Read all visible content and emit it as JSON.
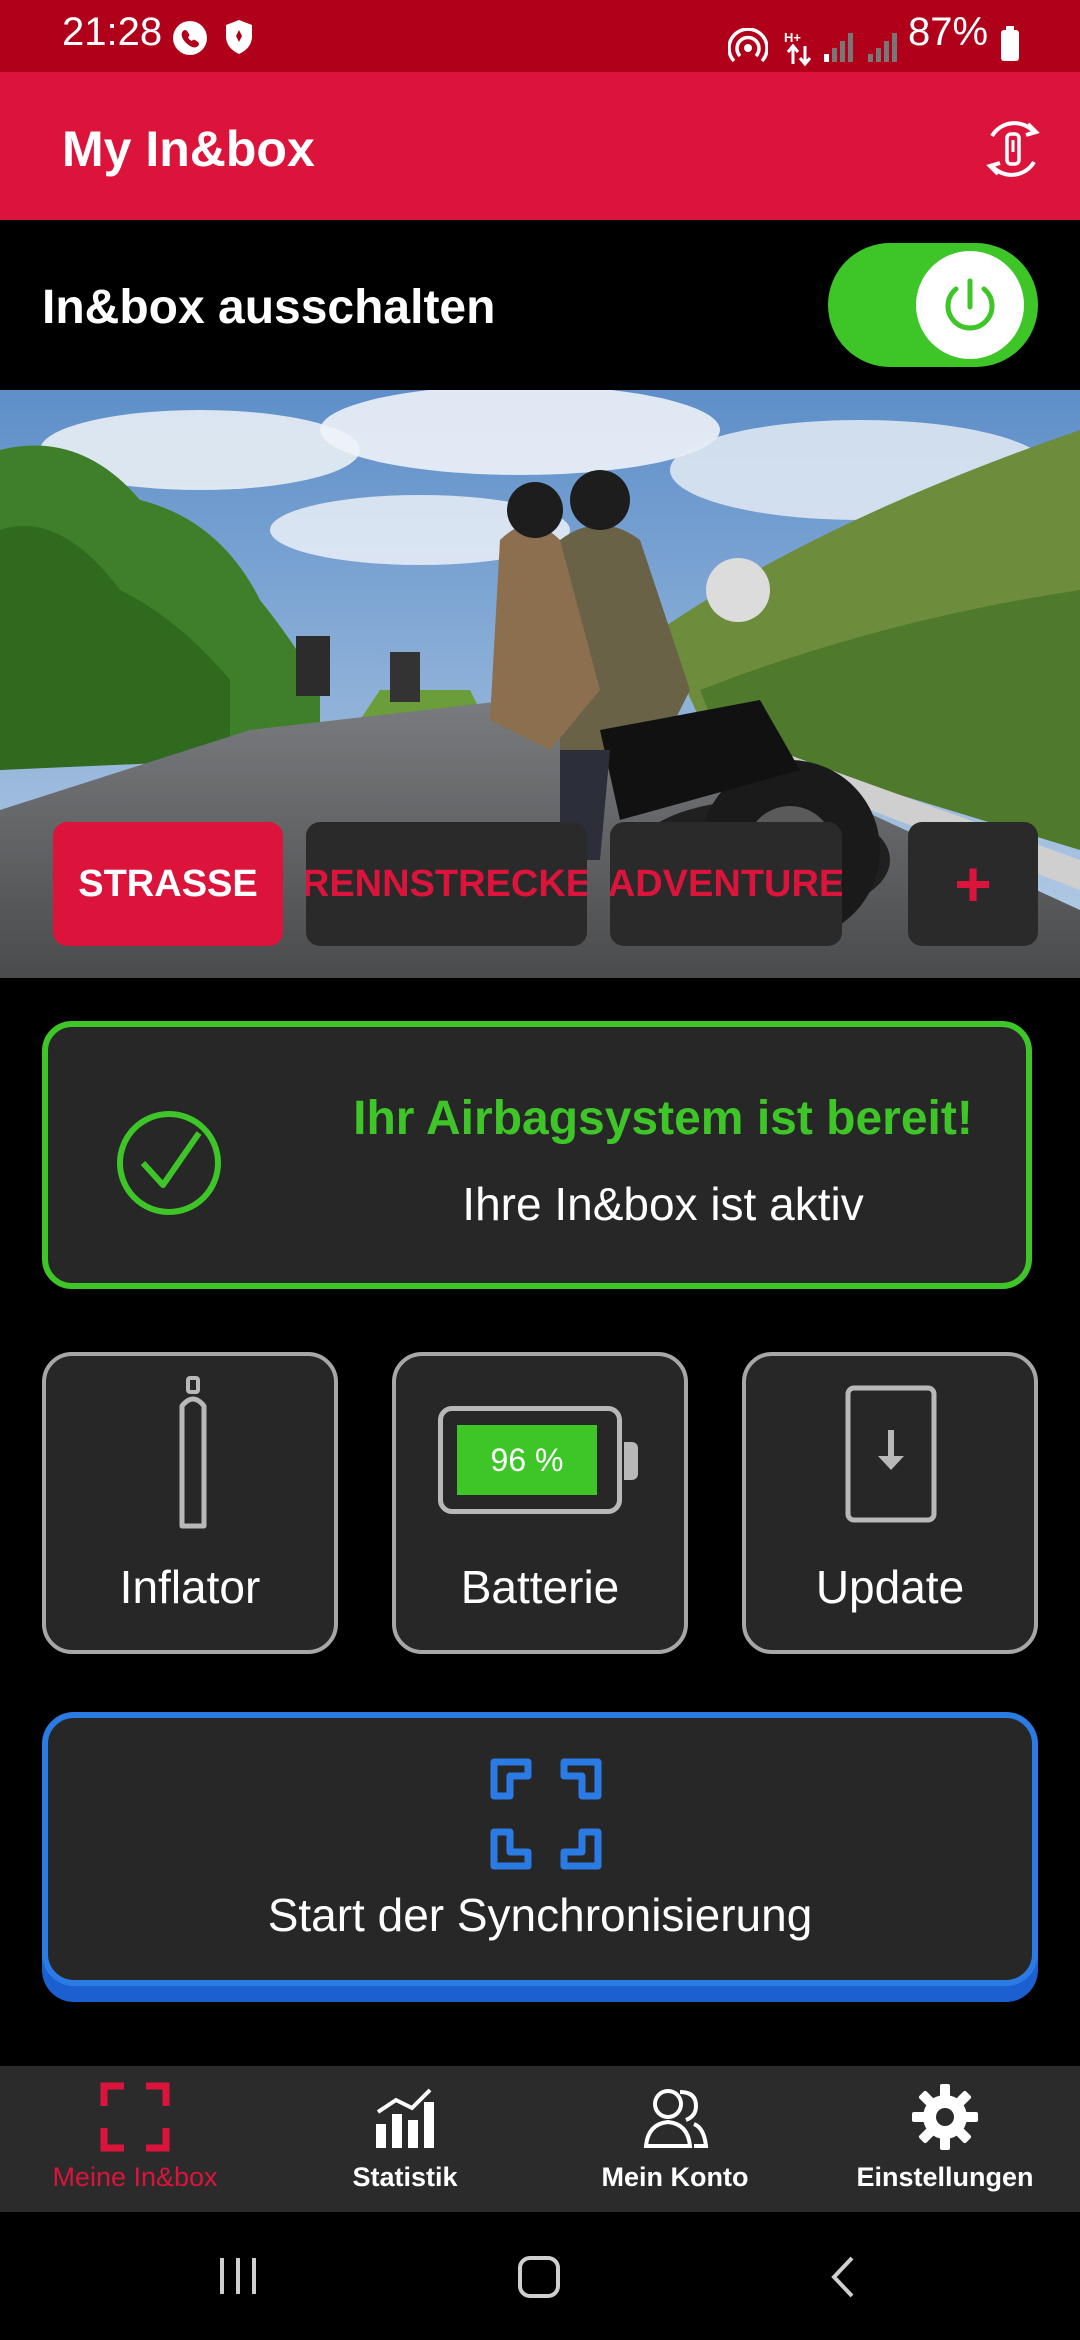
{
  "status_bar": {
    "time": "21:28",
    "battery": "87%",
    "icons": [
      "phone-call-icon",
      "shield-icon",
      "hotspot-icon",
      "data-arrows-icon",
      "signal-icon",
      "signal-icon",
      "battery-icon"
    ]
  },
  "app_bar": {
    "title": "My In&box",
    "sync_icon": "device-sync-icon",
    "color": "#dc143c"
  },
  "toggle": {
    "label": "In&box ausschalten",
    "state": "on",
    "color": "#3ec629"
  },
  "modes": {
    "items": [
      {
        "label": "STRASSE",
        "active": true
      },
      {
        "label": "RENNSTRECKE",
        "active": false
      },
      {
        "label": "ADVENTURE",
        "active": false
      }
    ],
    "add_label": "+"
  },
  "status_card": {
    "title": "Ihr Airbagsystem ist bereit!",
    "subtitle": "Ihre In&box ist aktiv",
    "icon": "check-circle-icon"
  },
  "tiles": {
    "inflator": {
      "label": "Inflator",
      "icon": "gas-cylinder-icon"
    },
    "batterie": {
      "label": "Batterie",
      "percent_text": "96 %",
      "level": 0.96,
      "icon": "battery-icon"
    },
    "update": {
      "label": "Update",
      "icon": "phone-download-icon"
    }
  },
  "sync": {
    "label": "Start der Synchronisierung",
    "icon": "scan-frame-icon",
    "color": "#2a7be4"
  },
  "bottom_nav": {
    "items": [
      {
        "label": "Meine In&box",
        "icon": "frame-corners-icon",
        "active": true
      },
      {
        "label": "Statistik",
        "icon": "bar-chart-icon",
        "active": false
      },
      {
        "label": "Mein Konto",
        "icon": "users-icon",
        "active": false
      },
      {
        "label": "Einstellungen",
        "icon": "gear-icon",
        "active": false
      }
    ]
  }
}
